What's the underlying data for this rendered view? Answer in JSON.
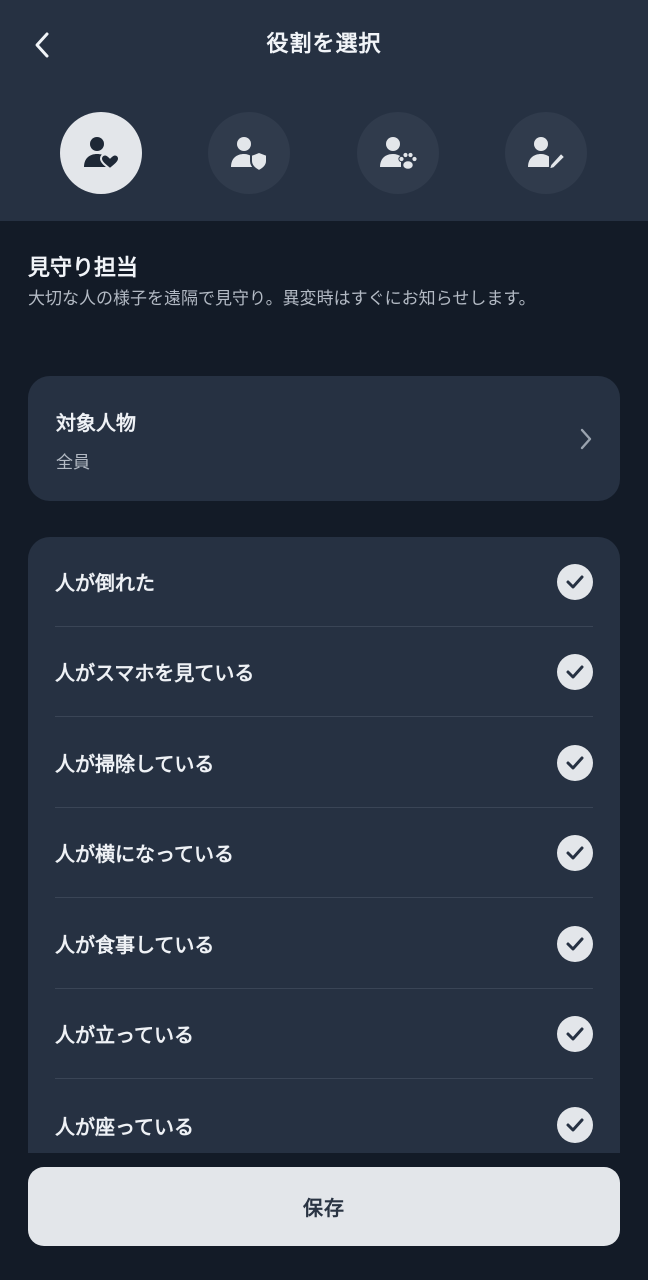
{
  "header": {
    "title": "役割を選択",
    "back_icon": "chevron-left-icon"
  },
  "roles": [
    {
      "icon": "person-heart-icon",
      "selected": true
    },
    {
      "icon": "person-shield-icon",
      "selected": false
    },
    {
      "icon": "person-paw-icon",
      "selected": false
    },
    {
      "icon": "person-pencil-icon",
      "selected": false
    }
  ],
  "selected_role": {
    "name": "見守り担当",
    "description": "大切な人の様子を遠隔で見守り。異変時はすぐにお知らせします。"
  },
  "target": {
    "label": "対象人物",
    "value": "全員"
  },
  "events": [
    {
      "label": "人が倒れた",
      "checked": true
    },
    {
      "label": "人がスマホを見ている",
      "checked": true
    },
    {
      "label": "人が掃除している",
      "checked": true
    },
    {
      "label": "人が横になっている",
      "checked": true
    },
    {
      "label": "人が食事している",
      "checked": true
    },
    {
      "label": "人が立っている",
      "checked": true
    },
    {
      "label": "人が座っている",
      "checked": true
    }
  ],
  "footer": {
    "save_label": "保存"
  },
  "colors": {
    "background": "#131b27",
    "surface": "#263142",
    "icon_circle": "#303b4c",
    "active_circle": "#e3e6ea",
    "divider": "#3a4556"
  }
}
